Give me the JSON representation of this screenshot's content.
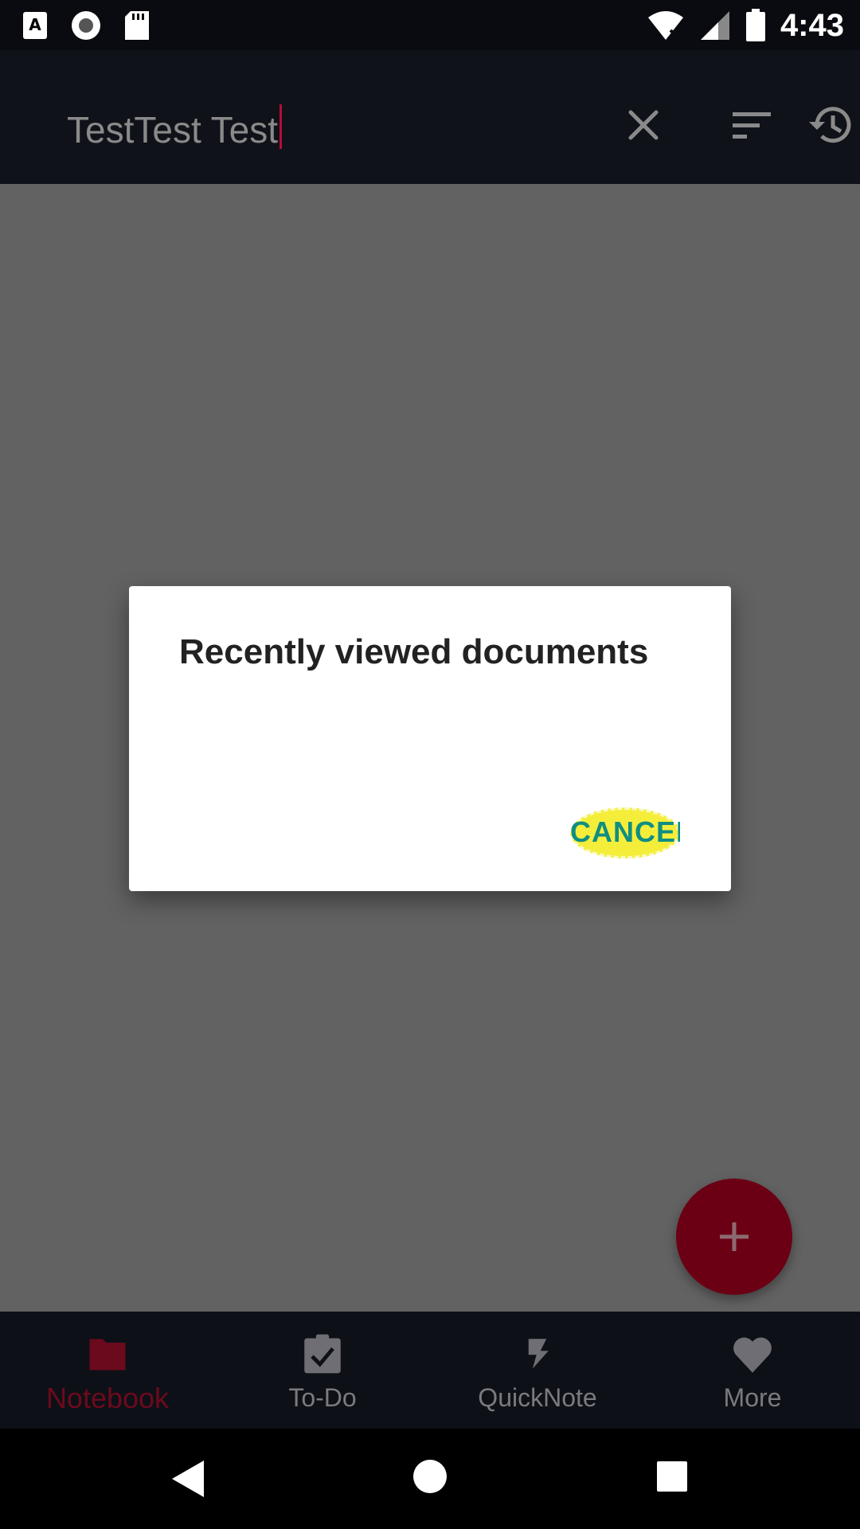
{
  "status_bar": {
    "time": "4:43"
  },
  "toolbar": {
    "search_value": "TestTest Test"
  },
  "dialog": {
    "title": "Recently viewed documents",
    "cancel_label": "CANCEL"
  },
  "bottom_nav": {
    "items": [
      {
        "label": "Notebook",
        "icon": "folder-icon",
        "active": true
      },
      {
        "label": "To-Do",
        "icon": "clipboard-check-icon",
        "active": false
      },
      {
        "label": "QuickNote",
        "icon": "lightning-icon",
        "active": false
      },
      {
        "label": "More",
        "icon": "heart-icon",
        "active": false
      }
    ]
  },
  "colors": {
    "accent": "#6b0a1c",
    "toolbar_bg": "#10121a",
    "dim_bg": "#626262",
    "cancel_text": "#0f8e82"
  }
}
